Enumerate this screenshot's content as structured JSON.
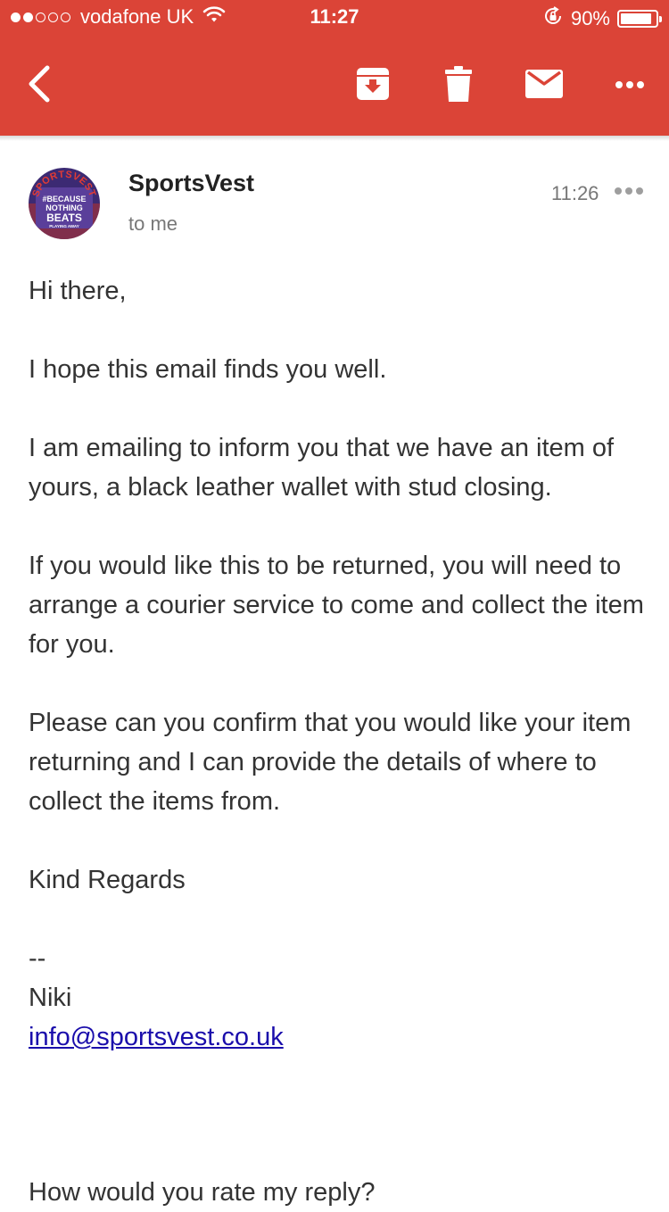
{
  "status_bar": {
    "signal_bars_filled": 2,
    "signal_bars_total": 5,
    "carrier": "vodafone UK",
    "time": "11:27",
    "battery_text": "90%",
    "battery_level": 0.9
  },
  "toolbar": {
    "icons": [
      "back-chevron-icon",
      "archive-icon",
      "trash-icon",
      "mail-icon",
      "more-horizontal-icon"
    ]
  },
  "message": {
    "sender": "SportsVest",
    "recipient": "to me",
    "time": "11:26",
    "avatar": {
      "brand_text": "SPORTSVEST",
      "slogan_lines": [
        "#BECAUSE",
        "NOTHING",
        "BEATS",
        "PLAYING AWAY"
      ]
    },
    "body": {
      "greeting": "Hi there,",
      "line1": "I hope this email finds you well.",
      "para2": "I am emailing to inform you that we have an item of yours, a black leather wallet with stud closing.",
      "para3": "If you would like this to be returned, you will need to arrange a courier service to come and collect the item for you.",
      "para4": "Please can you confirm that you would like your item returning and I can provide the details of where to collect the items from.",
      "signoff": "Kind Regards",
      "sig_separator": "--",
      "sig_name": "Niki",
      "sig_email": "info@sportsvest.co.uk",
      "rating_prompt": "How would you rate my reply?"
    }
  },
  "colors": {
    "header_red": "#db4437",
    "link_blue": "#1a0dab",
    "text_dark": "#333333",
    "text_muted": "#777777"
  }
}
